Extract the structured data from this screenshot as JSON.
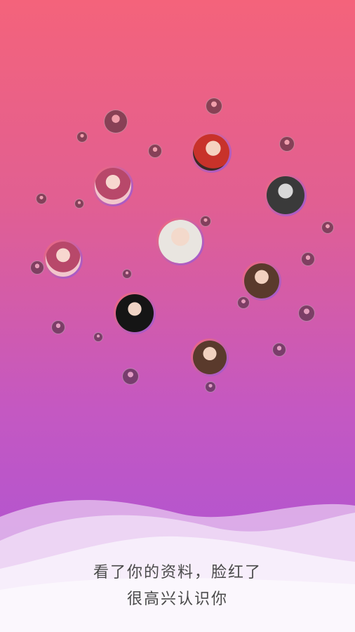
{
  "colors": {
    "gradient_top": "#f4637b",
    "gradient_bottom": "#a852d8",
    "caption_text": "#4a4a4a"
  },
  "bubbles": {
    "large": [
      {
        "name": "avatar-top-right-red",
        "style": "warm"
      },
      {
        "name": "avatar-left-pink",
        "style": "pink"
      },
      {
        "name": "avatar-right-monochrome",
        "style": "bw"
      },
      {
        "name": "avatar-center-light",
        "style": "light"
      },
      {
        "name": "avatar-left-middle",
        "style": "pink"
      },
      {
        "name": "avatar-right-middle",
        "style": "brown"
      },
      {
        "name": "avatar-center-dark",
        "style": "dark"
      },
      {
        "name": "avatar-bottom-center",
        "style": "brown"
      }
    ],
    "small_count": 22
  },
  "caption": {
    "line1": "看了你的资料，脸红了",
    "line2": "很高兴认识你"
  }
}
